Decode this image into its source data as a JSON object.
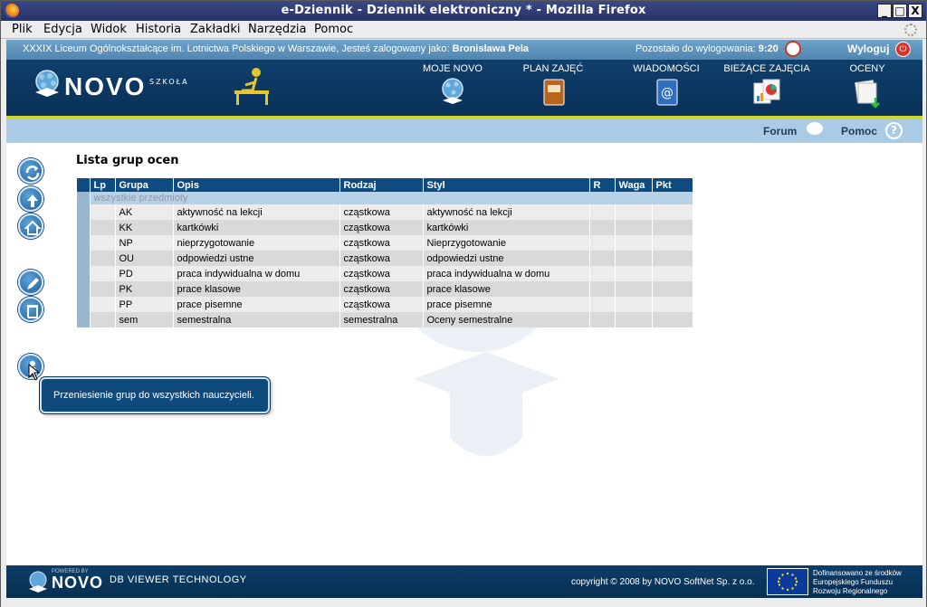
{
  "window": {
    "title": "e-Dziennik - Dziennik elektroniczny * - Mozilla Firefox",
    "minimize": "_",
    "maximize": "□",
    "close": "X"
  },
  "menu": [
    "Plik",
    "Edycja",
    "Widok",
    "Historia",
    "Zakładki",
    "Narzędzia",
    "Pomoc"
  ],
  "topinfo": {
    "school": "XXXIX Liceum Ogólnokształcące im. Lotnictwa Polskiego w Warszawie, Jesteś zalogowany jako: ",
    "user": "Bronisława Pela",
    "timer_label": "Pozostało do wylogowania: ",
    "timer_value": "9:20",
    "logout": "Wyloguj"
  },
  "logo": {
    "word": "NOVO",
    "sub": "SZKOŁA"
  },
  "nav": [
    {
      "label": "MOJE NOVO",
      "icon": "globe-student-icon"
    },
    {
      "label": "PLAN ZAJĘĆ",
      "icon": "schedule-book-icon"
    },
    {
      "label": "WIADOMOŚCI",
      "icon": "mail-book-icon"
    },
    {
      "label": "BIEŻĄCE ZAJĘCIA",
      "icon": "charts-icon"
    },
    {
      "label": "OCENY",
      "icon": "grades-icon"
    }
  ],
  "subbar": {
    "forum": "Forum",
    "help": "Pomoc",
    "help_glyph": "?"
  },
  "content": {
    "title": "Lista grup ocen",
    "columns": [
      "",
      "Lp",
      "Grupa",
      "Opis",
      "Rodzaj",
      "Styl",
      "R",
      "Waga",
      "Pkt"
    ],
    "group_label": "wszystkie przedmioty",
    "rows": [
      {
        "lp": "",
        "grupa": "AK",
        "opis": "aktywność na lekcji",
        "rodzaj": "cząstkowa",
        "styl": "aktywność na lekcji",
        "r": "",
        "waga": "",
        "pkt": ""
      },
      {
        "lp": "",
        "grupa": "KK",
        "opis": "kartkówki",
        "rodzaj": "cząstkowa",
        "styl": "kartkówki",
        "r": "",
        "waga": "",
        "pkt": ""
      },
      {
        "lp": "",
        "grupa": "NP",
        "opis": "nieprzygotowanie",
        "rodzaj": "cząstkowa",
        "styl": "Nieprzygotowanie",
        "r": "",
        "waga": "",
        "pkt": ""
      },
      {
        "lp": "",
        "grupa": "OU",
        "opis": "odpowiedzi ustne",
        "rodzaj": "cząstkowa",
        "styl": "odpowiedzi ustne",
        "r": "",
        "waga": "",
        "pkt": ""
      },
      {
        "lp": "",
        "grupa": "PD",
        "opis": "praca indywidualna w domu",
        "rodzaj": "cząstkowa",
        "styl": "praca indywidualna w domu",
        "r": "",
        "waga": "",
        "pkt": ""
      },
      {
        "lp": "",
        "grupa": "PK",
        "opis": "prace klasowe",
        "rodzaj": "cząstkowa",
        "styl": "prace klasowe",
        "r": "",
        "waga": "",
        "pkt": ""
      },
      {
        "lp": "",
        "grupa": "PP",
        "opis": "prace pisemne",
        "rodzaj": "cząstkowa",
        "styl": "prace pisemne",
        "r": "",
        "waga": "",
        "pkt": ""
      },
      {
        "lp": "",
        "grupa": "sem",
        "opis": "semestralna",
        "rodzaj": "semestralna",
        "styl": "Oceny semestralne",
        "r": "",
        "waga": "",
        "pkt": ""
      }
    ]
  },
  "tooltip": "Przeniesienie grup do wszystkich nauczycieli.",
  "footer": {
    "powered": "POWERED BY",
    "novo": "NOVO",
    "tech": "DB VIEWER TECHNOLOGY",
    "copyright": "copyright © 2008 by NOVO SoftNet Sp. z o.o.",
    "eu_text": [
      "Dofinansowano ze środków",
      "Europejskiego Funduszu",
      "Rozwoju Regionalnego"
    ]
  },
  "colors": {
    "header": "#0e3f6b",
    "accent_line": "#cfd830",
    "table_header": "#0d4b80",
    "subbar": "#a9cbe6"
  }
}
